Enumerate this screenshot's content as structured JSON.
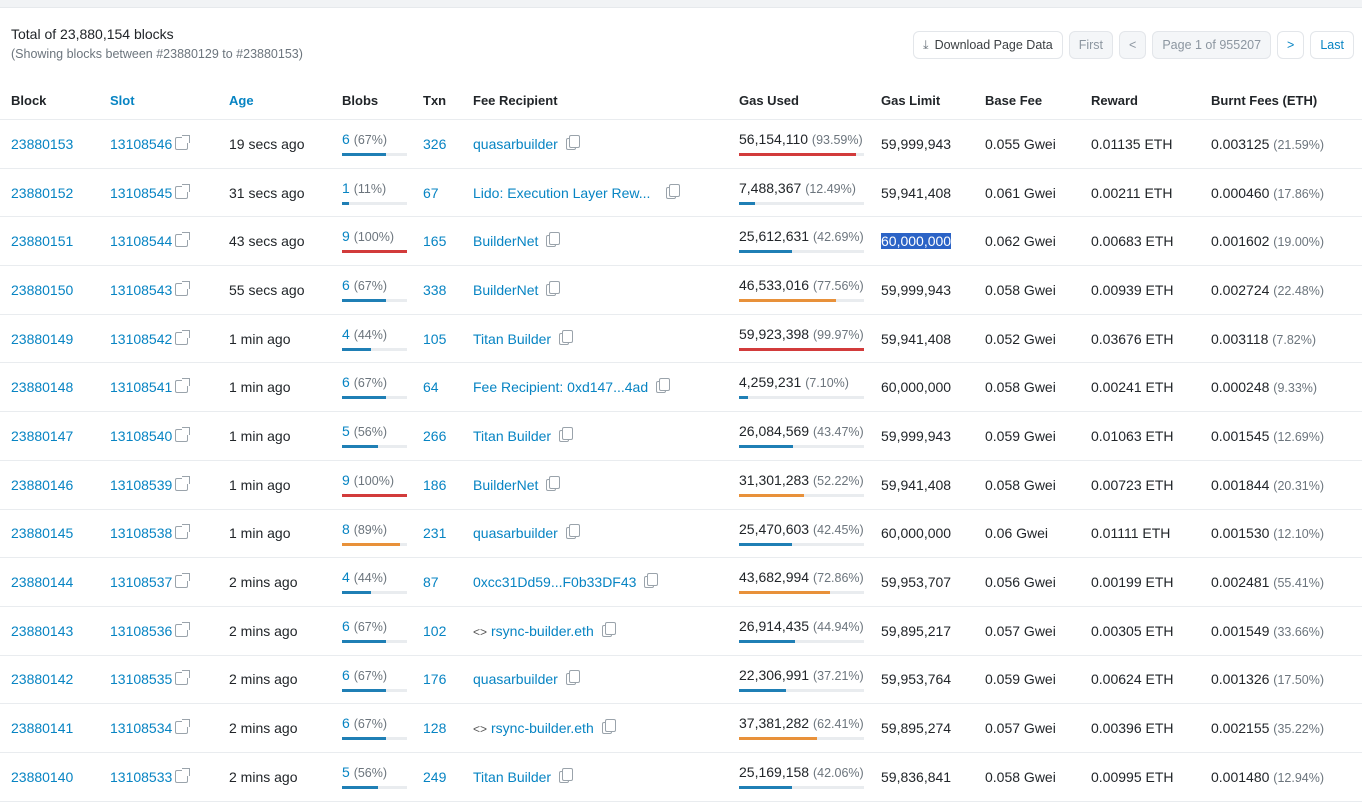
{
  "summary": {
    "total": "Total of 23,880,154 blocks",
    "showing": "(Showing blocks between #23880129 to #23880153)"
  },
  "pager": {
    "download": "Download Page Data",
    "first": "First",
    "prev": "<",
    "page": "Page 1 of 955207",
    "next": ">",
    "last": "Last"
  },
  "headers": [
    "Block",
    "Slot",
    "Age",
    "Blobs",
    "Txn",
    "Fee Recipient",
    "Gas Used",
    "Gas Limit",
    "Base Fee",
    "Reward",
    "Burnt Fees (ETH)"
  ],
  "colors": {
    "blue": "#1f7fb5",
    "orange": "#e8913a",
    "red": "#d23b3b"
  },
  "rows": [
    {
      "block": "23880153",
      "slot": "13108546",
      "age": "19 secs ago",
      "blobs": "6",
      "blobs_pct": "(67%)",
      "blobs_fill": 67,
      "blobs_color": "blue",
      "txn": "326",
      "recipient": "quasarbuilder",
      "gas": "56,154,110",
      "gas_pct": "(93.59%)",
      "gas_fill": 93.59,
      "gas_color": "red",
      "limit": "59,999,943",
      "base": "0.055 Gwei",
      "reward": "0.01135 ETH",
      "burnt": "0.003125",
      "burnt_pct": "(21.59%)"
    },
    {
      "block": "23880152",
      "slot": "13108545",
      "age": "31 secs ago",
      "blobs": "1",
      "blobs_pct": "(11%)",
      "blobs_fill": 11,
      "blobs_color": "blue",
      "txn": "67",
      "recipient": "Lido: Execution Layer Rew...",
      "gas": "7,488,367",
      "gas_pct": "(12.49%)",
      "gas_fill": 12.49,
      "gas_color": "blue",
      "limit": "59,941,408",
      "base": "0.061 Gwei",
      "reward": "0.00211 ETH",
      "burnt": "0.000460",
      "burnt_pct": "(17.86%)"
    },
    {
      "block": "23880151",
      "slot": "13108544",
      "age": "43 secs ago",
      "blobs": "9",
      "blobs_pct": "(100%)",
      "blobs_fill": 100,
      "blobs_color": "red",
      "txn": "165",
      "recipient": "BuilderNet",
      "gas": "25,612,631",
      "gas_pct": "(42.69%)",
      "gas_fill": 42.69,
      "gas_color": "blue",
      "limit": "60,000,000",
      "selected": true,
      "base": "0.062 Gwei",
      "reward": "0.00683 ETH",
      "burnt": "0.001602",
      "burnt_pct": "(19.00%)"
    },
    {
      "block": "23880150",
      "slot": "13108543",
      "age": "55 secs ago",
      "blobs": "6",
      "blobs_pct": "(67%)",
      "blobs_fill": 67,
      "blobs_color": "blue",
      "txn": "338",
      "recipient": "BuilderNet",
      "gas": "46,533,016",
      "gas_pct": "(77.56%)",
      "gas_fill": 77.56,
      "gas_color": "orange",
      "limit": "59,999,943",
      "base": "0.058 Gwei",
      "reward": "0.00939 ETH",
      "burnt": "0.002724",
      "burnt_pct": "(22.48%)"
    },
    {
      "block": "23880149",
      "slot": "13108542",
      "age": "1 min ago",
      "blobs": "4",
      "blobs_pct": "(44%)",
      "blobs_fill": 44,
      "blobs_color": "blue",
      "txn": "105",
      "recipient": "Titan Builder",
      "gas": "59,923,398",
      "gas_pct": "(99.97%)",
      "gas_fill": 99.97,
      "gas_color": "red",
      "limit": "59,941,408",
      "base": "0.052 Gwei",
      "reward": "0.03676 ETH",
      "burnt": "0.003118",
      "burnt_pct": "(7.82%)"
    },
    {
      "block": "23880148",
      "slot": "13108541",
      "age": "1 min ago",
      "blobs": "6",
      "blobs_pct": "(67%)",
      "blobs_fill": 67,
      "blobs_color": "blue",
      "txn": "64",
      "recipient": "Fee Recipient: 0xd147...4ad",
      "gas": "4,259,231",
      "gas_pct": "(7.10%)",
      "gas_fill": 7.1,
      "gas_color": "blue",
      "limit": "60,000,000",
      "base": "0.058 Gwei",
      "reward": "0.00241 ETH",
      "burnt": "0.000248",
      "burnt_pct": "(9.33%)"
    },
    {
      "block": "23880147",
      "slot": "13108540",
      "age": "1 min ago",
      "blobs": "5",
      "blobs_pct": "(56%)",
      "blobs_fill": 56,
      "blobs_color": "blue",
      "txn": "266",
      "recipient": "Titan Builder",
      "gas": "26,084,569",
      "gas_pct": "(43.47%)",
      "gas_fill": 43.47,
      "gas_color": "blue",
      "limit": "59,999,943",
      "base": "0.059 Gwei",
      "reward": "0.01063 ETH",
      "burnt": "0.001545",
      "burnt_pct": "(12.69%)"
    },
    {
      "block": "23880146",
      "slot": "13108539",
      "age": "1 min ago",
      "blobs": "9",
      "blobs_pct": "(100%)",
      "blobs_fill": 100,
      "blobs_color": "red",
      "txn": "186",
      "recipient": "BuilderNet",
      "gas": "31,301,283",
      "gas_pct": "(52.22%)",
      "gas_fill": 52.22,
      "gas_color": "orange",
      "limit": "59,941,408",
      "base": "0.058 Gwei",
      "reward": "0.00723 ETH",
      "burnt": "0.001844",
      "burnt_pct": "(20.31%)"
    },
    {
      "block": "23880145",
      "slot": "13108538",
      "age": "1 min ago",
      "blobs": "8",
      "blobs_pct": "(89%)",
      "blobs_fill": 89,
      "blobs_color": "orange",
      "txn": "231",
      "recipient": "quasarbuilder",
      "gas": "25,470,603",
      "gas_pct": "(42.45%)",
      "gas_fill": 42.45,
      "gas_color": "blue",
      "limit": "60,000,000",
      "base": "0.06 Gwei",
      "reward": "0.01111 ETH",
      "burnt": "0.001530",
      "burnt_pct": "(12.10%)"
    },
    {
      "block": "23880144",
      "slot": "13108537",
      "age": "2 mins ago",
      "blobs": "4",
      "blobs_pct": "(44%)",
      "blobs_fill": 44,
      "blobs_color": "blue",
      "txn": "87",
      "recipient": "0xcc31Dd59...F0b33DF43",
      "gas": "43,682,994",
      "gas_pct": "(72.86%)",
      "gas_fill": 72.86,
      "gas_color": "orange",
      "limit": "59,953,707",
      "base": "0.056 Gwei",
      "reward": "0.00199 ETH",
      "burnt": "0.002481",
      "burnt_pct": "(55.41%)"
    },
    {
      "block": "23880143",
      "slot": "13108536",
      "age": "2 mins ago",
      "blobs": "6",
      "blobs_pct": "(67%)",
      "blobs_fill": 67,
      "blobs_color": "blue",
      "txn": "102",
      "recipient": "rsync-builder.eth",
      "code_icon": true,
      "gas": "26,914,435",
      "gas_pct": "(44.94%)",
      "gas_fill": 44.94,
      "gas_color": "blue",
      "limit": "59,895,217",
      "base": "0.057 Gwei",
      "reward": "0.00305 ETH",
      "burnt": "0.001549",
      "burnt_pct": "(33.66%)"
    },
    {
      "block": "23880142",
      "slot": "13108535",
      "age": "2 mins ago",
      "blobs": "6",
      "blobs_pct": "(67%)",
      "blobs_fill": 67,
      "blobs_color": "blue",
      "txn": "176",
      "recipient": "quasarbuilder",
      "gas": "22,306,991",
      "gas_pct": "(37.21%)",
      "gas_fill": 37.21,
      "gas_color": "blue",
      "limit": "59,953,764",
      "base": "0.059 Gwei",
      "reward": "0.00624 ETH",
      "burnt": "0.001326",
      "burnt_pct": "(17.50%)"
    },
    {
      "block": "23880141",
      "slot": "13108534",
      "age": "2 mins ago",
      "blobs": "6",
      "blobs_pct": "(67%)",
      "blobs_fill": 67,
      "blobs_color": "blue",
      "txn": "128",
      "recipient": "rsync-builder.eth",
      "code_icon": true,
      "gas": "37,381,282",
      "gas_pct": "(62.41%)",
      "gas_fill": 62.41,
      "gas_color": "orange",
      "limit": "59,895,274",
      "base": "0.057 Gwei",
      "reward": "0.00396 ETH",
      "burnt": "0.002155",
      "burnt_pct": "(35.22%)"
    },
    {
      "block": "23880140",
      "slot": "13108533",
      "age": "2 mins ago",
      "blobs": "5",
      "blobs_pct": "(56%)",
      "blobs_fill": 56,
      "blobs_color": "blue",
      "txn": "249",
      "recipient": "Titan Builder",
      "gas": "25,169,158",
      "gas_pct": "(42.06%)",
      "gas_fill": 42.06,
      "gas_color": "blue",
      "limit": "59,836,841",
      "base": "0.058 Gwei",
      "reward": "0.00995 ETH",
      "burnt": "0.001480",
      "burnt_pct": "(12.94%)"
    }
  ]
}
